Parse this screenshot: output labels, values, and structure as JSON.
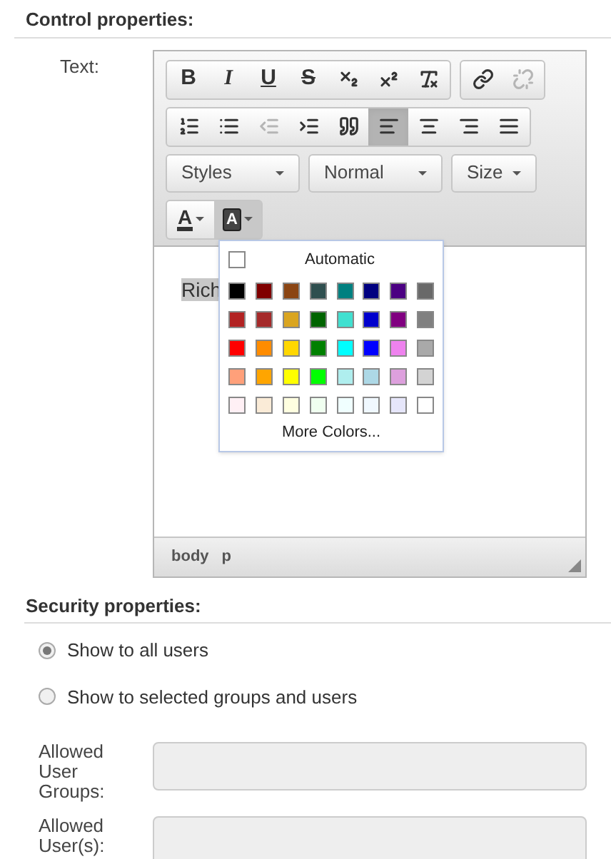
{
  "control_section": {
    "title": "Control properties:",
    "field_label": "Text:"
  },
  "editor": {
    "toolbar_groups": [
      [
        {
          "kind": "bold",
          "label": "B",
          "pressed": false,
          "disabled": false
        },
        {
          "kind": "italic",
          "label": "I",
          "pressed": false,
          "disabled": false
        },
        {
          "kind": "underline",
          "label": "U",
          "pressed": false,
          "disabled": false
        },
        {
          "kind": "strike",
          "label": "S",
          "pressed": false,
          "disabled": false
        },
        {
          "kind": "subscript",
          "pressed": false,
          "disabled": false
        },
        {
          "kind": "superscript",
          "pressed": false,
          "disabled": false
        },
        {
          "kind": "clear",
          "pressed": false,
          "disabled": false
        }
      ],
      [
        {
          "kind": "link",
          "pressed": false,
          "disabled": false
        },
        {
          "kind": "unlink",
          "pressed": false,
          "disabled": true
        }
      ],
      [
        {
          "kind": "ordered",
          "pressed": false,
          "disabled": false
        },
        {
          "kind": "bullets",
          "pressed": false,
          "disabled": false
        },
        {
          "kind": "outdent",
          "pressed": false,
          "disabled": true
        },
        {
          "kind": "indent",
          "pressed": false,
          "disabled": false
        },
        {
          "kind": "quote",
          "pressed": false,
          "disabled": false
        },
        {
          "kind": "left",
          "pressed": true,
          "disabled": false
        },
        {
          "kind": "center",
          "pressed": false,
          "disabled": false
        },
        {
          "kind": "right",
          "pressed": false,
          "disabled": false
        },
        {
          "kind": "justify",
          "pressed": false,
          "disabled": false
        }
      ]
    ],
    "dropdowns": [
      "Styles",
      "Normal",
      "Size"
    ],
    "color_buttons": [
      {
        "kind": "text",
        "label": "A",
        "open": false
      },
      {
        "kind": "background",
        "label": "A",
        "open": true
      }
    ],
    "content": "Rich",
    "palette": {
      "automatic": "Automatic",
      "more": "More Colors...",
      "colors": [
        {
          "color": "#000000"
        },
        {
          "color": "#800000"
        },
        {
          "color": "#8b4513"
        },
        {
          "color": "#2f4f4f"
        },
        {
          "color": "#008080"
        },
        {
          "color": "#000080"
        },
        {
          "color": "#4b0082"
        },
        {
          "color": "#696969"
        },
        {
          "color": "#b22222"
        },
        {
          "color": "#a52a2a"
        },
        {
          "color": "#daa520"
        },
        {
          "color": "#006400"
        },
        {
          "color": "#40e0d0"
        },
        {
          "color": "#0000cd"
        },
        {
          "color": "#800080"
        },
        {
          "color": "#808080"
        },
        {
          "color": "#ff0000"
        },
        {
          "color": "#ff8c00"
        },
        {
          "color": "#ffd700"
        },
        {
          "color": "#008000"
        },
        {
          "color": "#00ffff"
        },
        {
          "color": "#0000ff"
        },
        {
          "color": "#ee82ee"
        },
        {
          "color": "#a9a9a9"
        },
        {
          "color": "#ffa07a"
        },
        {
          "color": "#ffa500"
        },
        {
          "color": "#ffff00"
        },
        {
          "color": "#00ff00"
        },
        {
          "color": "#afeeee"
        },
        {
          "color": "#add8e6"
        },
        {
          "color": "#dda0dd"
        },
        {
          "color": "#d3d3d3"
        },
        {
          "color": "#fff0f5"
        },
        {
          "color": "#faebd7"
        },
        {
          "color": "#ffffe0"
        },
        {
          "color": "#f0fff0"
        },
        {
          "color": "#f0ffff"
        },
        {
          "color": "#f0f8ff"
        },
        {
          "color": "#e6e6fa"
        },
        {
          "color": "#ffffff"
        }
      ]
    },
    "path": [
      "body",
      "p"
    ]
  },
  "security_section": {
    "title": "Security properties:",
    "options": [
      {
        "label": "Show to all users",
        "selected": true
      },
      {
        "label": "Show to selected groups and users",
        "selected": false
      }
    ],
    "fields": [
      {
        "label": "Allowed User Groups:",
        "disabled": true
      },
      {
        "label": "Allowed User(s):",
        "disabled": true
      }
    ]
  }
}
